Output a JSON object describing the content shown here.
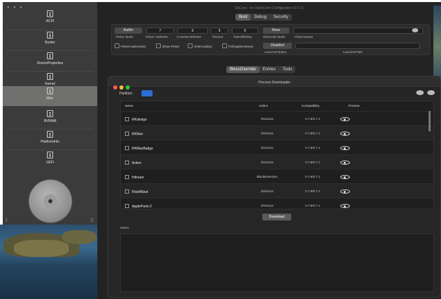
{
  "app": {
    "title": "OpCore - for OpenCore Configuration (0.7.2)"
  },
  "sidebar": {
    "items": [
      {
        "label": "ACPI"
      },
      {
        "label": "Booter"
      },
      {
        "label": "DeviceProperties"
      },
      {
        "label": "Kernel"
      },
      {
        "label": "Misc",
        "active": true
      },
      {
        "label": "NVRAM"
      },
      {
        "label": "PlatformInfo"
      },
      {
        "label": "UEFI"
      }
    ]
  },
  "top_tabs": [
    "Boot",
    "Debug",
    "Security"
  ],
  "boot": {
    "picker_mode": {
      "value": "BuiltIn",
      "caption": "Picker Mode"
    },
    "picker_attributes": {
      "value": "7",
      "caption": "Picker Attributes"
    },
    "console_attributes": {
      "value": "0",
      "caption": "ConsoleAttributes"
    },
    "timeout": {
      "value": "5",
      "caption": "Timeout"
    },
    "takeoff_delay": {
      "value": "0",
      "caption": "TakeOffDelay"
    },
    "hibernate_mode": {
      "value": "None",
      "caption": "Hibernate Mode"
    },
    "picker_variant": {
      "value": "",
      "caption": "PickerVariant"
    },
    "checkboxes": [
      "PickerAudioAssist",
      "Show Picker",
      "HideAuxiliary",
      "PollAppleHotKeys"
    ],
    "launcher_option": {
      "value": "Disabled",
      "caption": "LauncherOption"
    },
    "launcher_path": {
      "value": "",
      "caption": "LauncherPath"
    }
  },
  "sub_tabs": [
    "BlessOverride",
    "Entries",
    "Tools"
  ],
  "downloader": {
    "title": "Process Downloader",
    "partition_label": "Partition:",
    "columns": [
      "Name",
      "Author",
      "Compatibility",
      "Preview"
    ],
    "rows": [
      {
        "name": "RKdesign",
        "author": "chris1111",
        "compat": "0.7.8/0.7.1"
      },
      {
        "name": "RKNoir",
        "author": "chris1111",
        "compat": "0.7.8/0.7.1"
      },
      {
        "name": "RKMacBadge",
        "author": "chris1111",
        "compat": "0.7.8/0.7.1"
      },
      {
        "name": "Action",
        "author": "chris1111",
        "compat": "0.7.8/0.7.1"
      },
      {
        "name": "Hitmark",
        "author": "BlackDetection",
        "compat": "0.7.8/0.7.1"
      },
      {
        "name": "FlashBlast",
        "author": "chris1111",
        "compat": "0.7.8/0.7.1"
      },
      {
        "name": "AppleParts-2",
        "author": "chris1111",
        "compat": "0.7.8/0.7.1"
      }
    ],
    "download_label": "Download",
    "status_label": "Status"
  },
  "colors": {
    "accent": "#2a6fd6",
    "close": "#ff5f57",
    "minimize": "#febc2e",
    "zoom": "#28c840"
  },
  "icons": {
    "sidebar": "list-icon",
    "preview": "eye-icon",
    "share": "share-icon",
    "lock": "lock-icon"
  }
}
